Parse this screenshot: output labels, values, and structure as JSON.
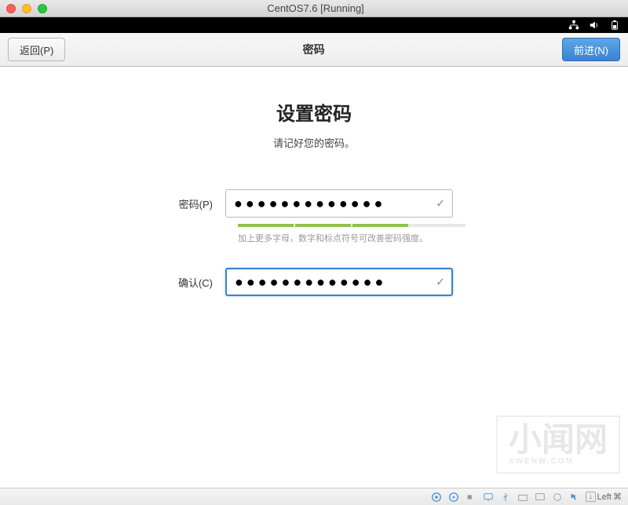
{
  "window": {
    "title": "CentOS7.6 [Running]"
  },
  "header": {
    "back_label": "返回(P)",
    "title": "密码",
    "forward_label": "前进(N)"
  },
  "main": {
    "title": "设置密码",
    "subtitle": "请记好您的密码。"
  },
  "form": {
    "password_label": "密码(P)",
    "password_value": "●●●●●●●●●●●●●",
    "confirm_label": "确认(C)",
    "confirm_value": "●●●●●●●●●●●●●",
    "hint": "加上更多字母，数字和标点符号可改善密码强度。",
    "strength_filled_segments": 3,
    "strength_total_segments": 4
  },
  "statusbar": {
    "left_key": "Left",
    "cmd_symbol": "⌘"
  },
  "watermark": {
    "text": "小闻网",
    "sub": "XWENW.COM"
  }
}
